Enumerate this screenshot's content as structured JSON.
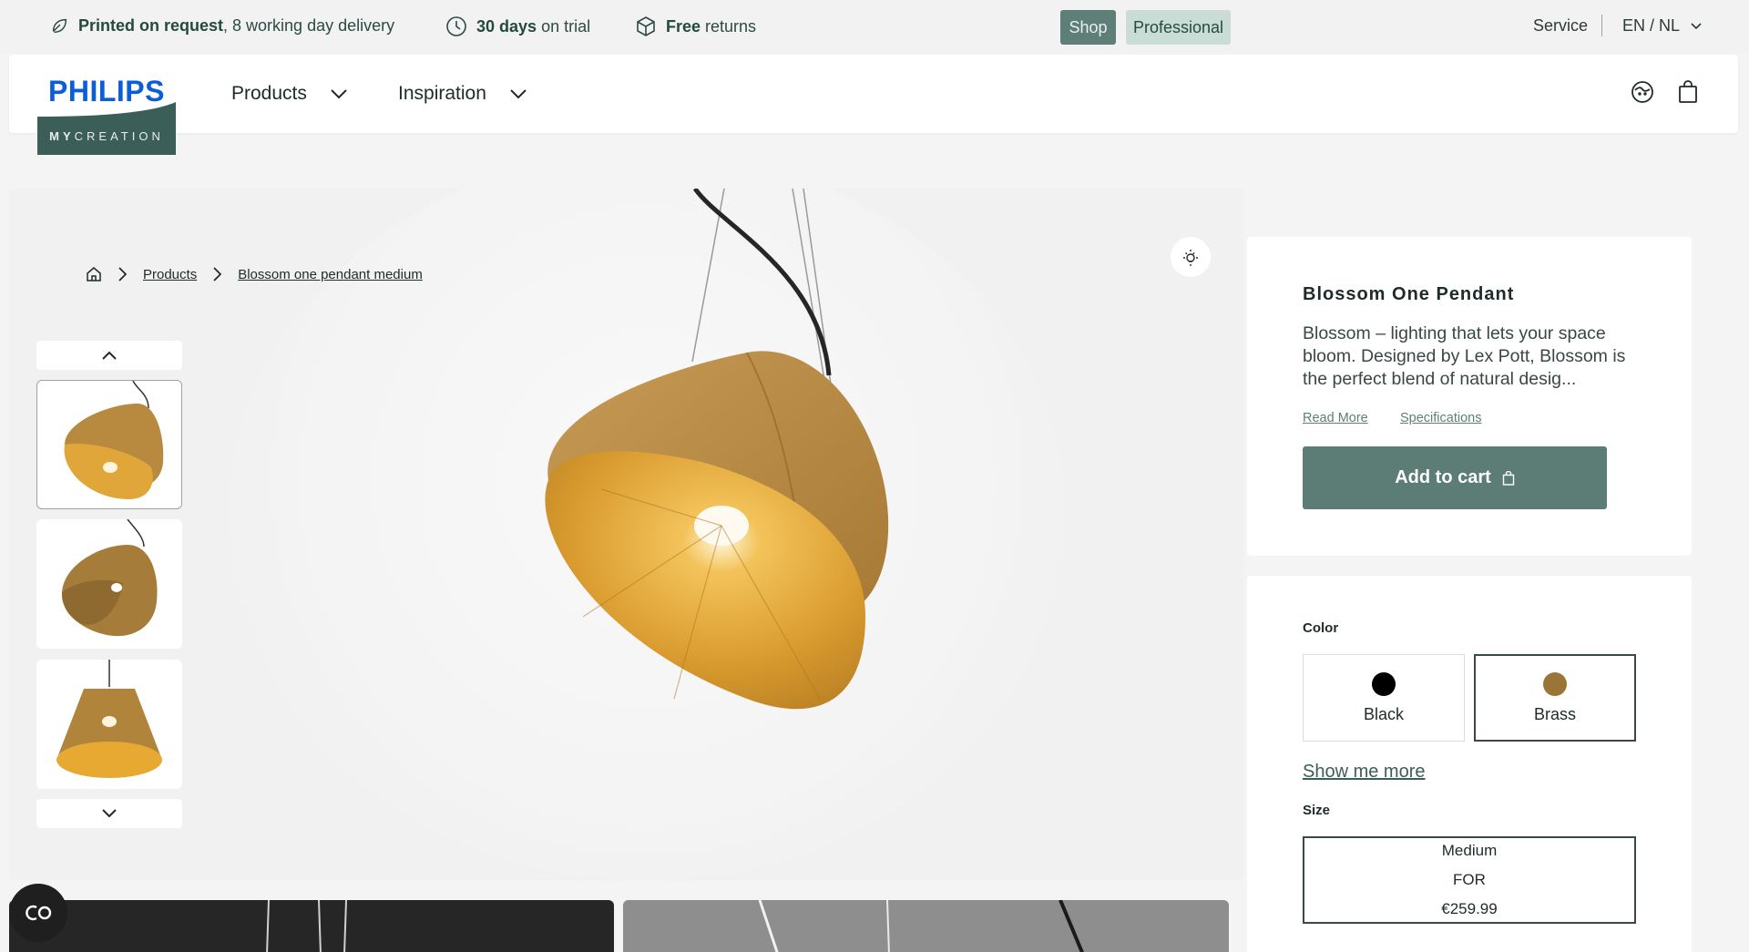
{
  "topbar": {
    "usps": [
      {
        "bold": "Printed on request",
        "rest": ", 8 working day delivery"
      },
      {
        "bold": "30 days",
        "rest": "on trial"
      },
      {
        "bold": "Free",
        "rest": "returns"
      }
    ],
    "shop_label": "Shop",
    "professional_label": "Professional",
    "service_label": "Service",
    "language_label": "EN / NL"
  },
  "header": {
    "logo_brand": "PHILIPS",
    "logo_sub_bold": "MY",
    "logo_sub_rest": "CREATION",
    "nav": [
      {
        "label": "Products"
      },
      {
        "label": "Inspiration"
      }
    ]
  },
  "breadcrumb": {
    "items": [
      "Products",
      "Blossom one pendant medium"
    ]
  },
  "product": {
    "title": "Blossom One Pendant",
    "description": "Blossom – lighting that lets your space bloom. Designed by Lex Pott, Blossom is the perfect blend of natural desig...",
    "read_more": "Read More",
    "specifications": "Specifications",
    "add_to_cart": "Add to cart",
    "color_label": "Color",
    "colors": [
      {
        "name": "Black",
        "hex": "#000000",
        "selected": false
      },
      {
        "name": "Brass",
        "hex": "#9a7536",
        "selected": true
      }
    ],
    "show_more": "Show me more",
    "size_label": "Size",
    "size": {
      "name": "Medium",
      "for": "FOR",
      "price": "€259.99"
    }
  },
  "colors": {
    "accent": "#5b7d75",
    "brand_blue": "#0b5ed7",
    "brass": "#c9962f"
  }
}
